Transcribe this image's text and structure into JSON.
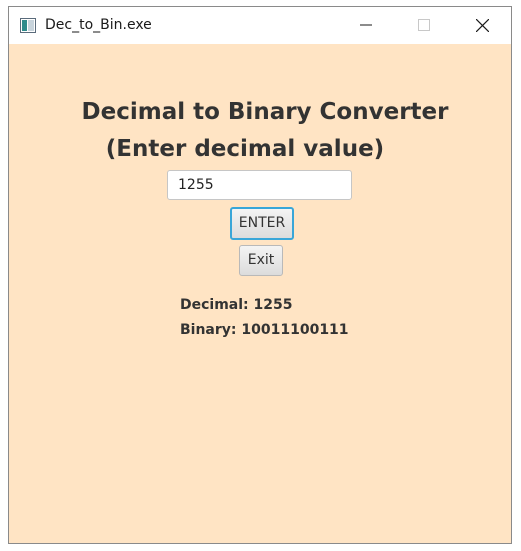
{
  "window": {
    "title": "Dec_to_Bin.exe",
    "background_color": "#ffe4c4",
    "controls": {
      "minimize_icon": "minimize-icon",
      "maximize_icon": "maximize-icon",
      "close_icon": "close-icon"
    }
  },
  "main": {
    "heading_line1": "Decimal to Binary Converter",
    "heading_line2": "(Enter decimal value)",
    "input_value": "1255",
    "enter_label": "ENTER",
    "exit_label": "Exit",
    "decimal_result": "Decimal: 1255",
    "binary_result": "Binary: 10011100111"
  },
  "colors": {
    "text": "#333333",
    "focus_accent": "#39a6d8"
  }
}
